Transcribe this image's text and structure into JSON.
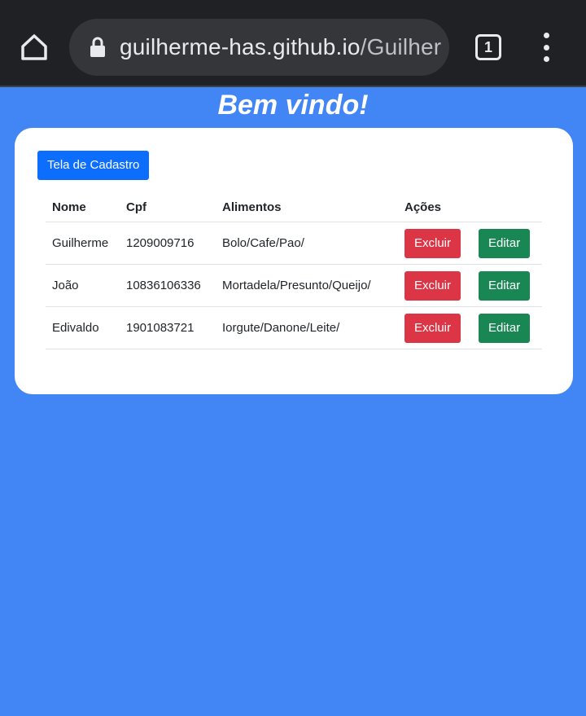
{
  "browser": {
    "url_host": "guilherme-has.github.io",
    "url_path": "/Guilher",
    "tab_count": "1"
  },
  "page": {
    "title": "Bem vindo!",
    "cadastro_button": "Tela de Cadastro"
  },
  "table": {
    "headers": {
      "nome": "Nome",
      "cpf": "Cpf",
      "alimentos": "Alimentos",
      "acoes": "Ações"
    },
    "rows": [
      {
        "nome": "Guilherme",
        "cpf": "1209009716",
        "alimentos": "Bolo/Cafe/Pao/",
        "delete_label": "Excluir",
        "edit_label": "Editar"
      },
      {
        "nome": "João",
        "cpf": "10836106336",
        "alimentos": "Mortadela/Presunto/Queijo/",
        "delete_label": "Excluir",
        "edit_label": "Editar"
      },
      {
        "nome": "Edivaldo",
        "cpf": "1901083721",
        "alimentos": "Iorgute/Danone/Leite/",
        "delete_label": "Excluir",
        "edit_label": "Editar"
      }
    ]
  },
  "colors": {
    "page_background": "#4285f4",
    "primary": "#0d6efd",
    "danger": "#dc3545",
    "success": "#198754",
    "browser_chrome": "#202124"
  },
  "icons": [
    "home-icon",
    "lock-icon",
    "tab-switcher-icon",
    "more-vert-icon"
  ]
}
